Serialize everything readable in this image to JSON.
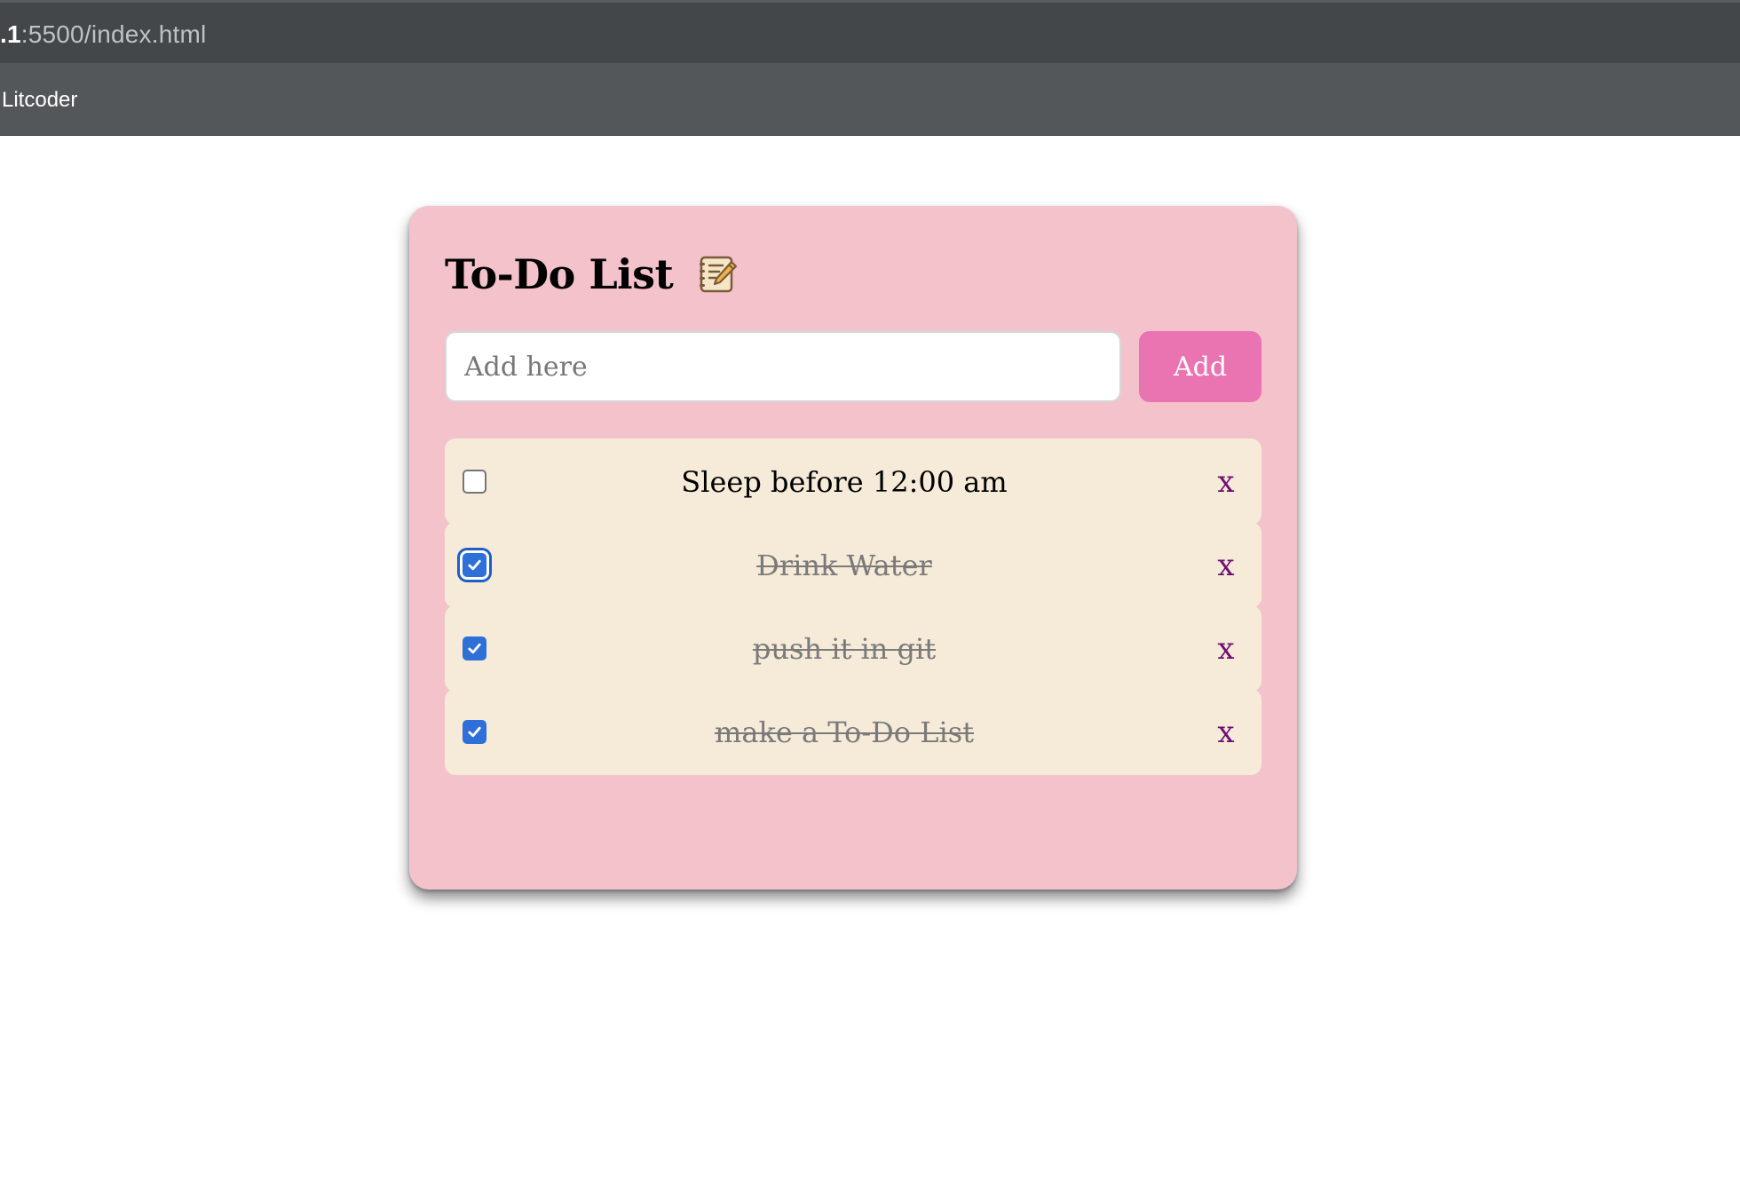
{
  "browser": {
    "url_host": ".1",
    "url_rest": ":5500/index.html",
    "bookmark": "Litcoder"
  },
  "app": {
    "title": "To-Do List",
    "title_icon": "notebook-pencil-icon",
    "input_placeholder": "Add here",
    "input_value": "",
    "add_label": "Add",
    "delete_label": "x",
    "colors": {
      "card": "#f4c2cb",
      "task_bg": "#f6ead8",
      "add_button": "#ea74b2",
      "delete_x": "#6e0f74",
      "checkbox": "#2f6fd8"
    },
    "tasks": [
      {
        "text": "Sleep before 12:00 am",
        "done": false
      },
      {
        "text": "Drink Water",
        "done": true
      },
      {
        "text": "push it in git",
        "done": true
      },
      {
        "text": "make a To-Do List",
        "done": true
      }
    ]
  }
}
